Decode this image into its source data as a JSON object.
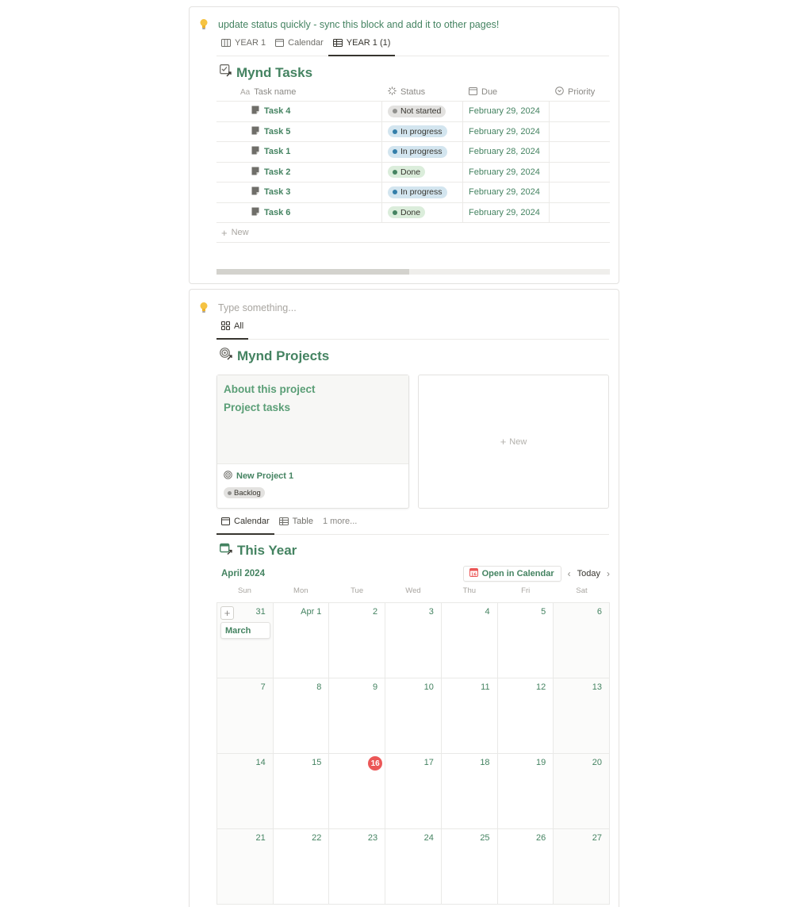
{
  "tasks_block": {
    "callout": "update status quickly - sync this block and add it to other pages!",
    "tabs": [
      "YEAR 1",
      "Calendar",
      "YEAR 1 (1)"
    ],
    "title": "Mynd Tasks",
    "columns": [
      "Task name",
      "Status",
      "Due",
      "Priority"
    ],
    "rows": [
      {
        "name": "Task 4",
        "status": "Not started",
        "status_kind": "gray",
        "due": "February 29, 2024"
      },
      {
        "name": "Task 5",
        "status": "In progress",
        "status_kind": "blue",
        "due": "February 29, 2024"
      },
      {
        "name": "Task 1",
        "status": "In progress",
        "status_kind": "blue",
        "due": "February 28, 2024"
      },
      {
        "name": "Task 2",
        "status": "Done",
        "status_kind": "green",
        "due": "February 29, 2024"
      },
      {
        "name": "Task 3",
        "status": "In progress",
        "status_kind": "blue",
        "due": "February 29, 2024"
      },
      {
        "name": "Task 6",
        "status": "Done",
        "status_kind": "green",
        "due": "February 29, 2024"
      }
    ],
    "new_label": "New",
    "colors": {
      "gray_bg": "#e3e2e0",
      "gray_dot": "#91918e",
      "blue_bg": "#d3e5ef",
      "blue_dot": "#337ea9",
      "green_bg": "#dbeddb",
      "green_dot": "#448361"
    }
  },
  "projects_block": {
    "callout_placeholder": "Type something...",
    "gallery_tab": "All",
    "title": "Mynd Projects",
    "card": {
      "preview_lines": [
        "About this project",
        "Project tasks"
      ],
      "name": "New Project 1",
      "badge": "Backlog"
    },
    "new_card_label": "New",
    "view_tabs": [
      "Calendar",
      "Table",
      "1 more..."
    ],
    "calendar_title": "This Year",
    "calendar": {
      "month": "April 2024",
      "open_button": "Open in Calendar",
      "today_button": "Today",
      "weekdays": [
        "Sun",
        "Mon",
        "Tue",
        "Wed",
        "Thu",
        "Fri",
        "Sat"
      ],
      "days": [
        "31",
        "Apr 1",
        "2",
        "3",
        "4",
        "5",
        "6",
        "7",
        "8",
        "9",
        "10",
        "11",
        "12",
        "13",
        "14",
        "15",
        "16",
        "17",
        "18",
        "19",
        "20",
        "21",
        "22",
        "23",
        "24",
        "25",
        "26",
        "27"
      ],
      "today": "16",
      "event": "March"
    }
  },
  "accent": "#448361",
  "today_color": "#eb5757"
}
